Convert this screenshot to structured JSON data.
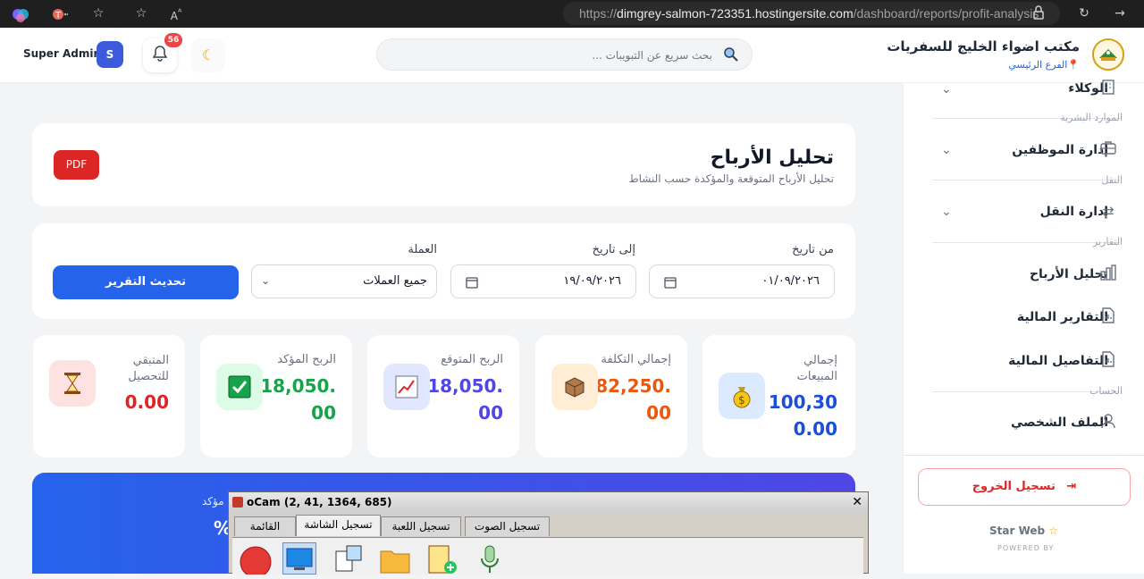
{
  "browser": {
    "url_prefix": "https://",
    "url_host": "dimgrey-salmon-723351.hostingersite.com",
    "url_path": "/dashboard/reports/profit-analysis"
  },
  "header": {
    "company_name": "مكتب اضواء الخليج للسفريات",
    "branch": "الفرع الرئيسي",
    "search_placeholder": "بحث سريع عن التبويبات ...",
    "notification_count": "56",
    "user_name": "Super Admin",
    "user_initial": "S"
  },
  "sidebar": {
    "agents": "الوكلاء",
    "section_hr": "الموارد البشرية",
    "employees": "إدارة الموظفين",
    "section_transport": "النقل",
    "transport": "إدارة النقل",
    "section_reports": "التقارير",
    "profit_analysis": "تحليل الأرباح",
    "financial_reports": "التقارير المالية",
    "financial_details": "التفاصيل المالية",
    "section_account": "الحساب",
    "profile": "الملف الشخصي",
    "logout": "تسجيل الخروج",
    "brand": "Star Web",
    "powered": "POWERED BY"
  },
  "page": {
    "title": "تحليل الأرباح",
    "subtitle": "تحليل الأرباح المتوقعة والمؤكدة حسب النشاط",
    "pdf_label": "PDF"
  },
  "filters": {
    "from_label": "من تاريخ",
    "from_value": "٠١/٠٩/٢٠٢٦",
    "to_label": "إلى تاريخ",
    "to_value": "١٩/٠٩/٢٠٢٦",
    "currency_label": "العملة",
    "currency_value": "جميع العملات",
    "update_button": "تحديث التقرير"
  },
  "stats": {
    "sales_label": "إجمالي المبيعات",
    "sales_value_1": "100,30",
    "sales_value_2": "0.00",
    "cost_label": "إجمالي التكلفة",
    "cost_value_1": "82,250.",
    "cost_value_2": "00",
    "expected_label": "الربح المتوقع",
    "expected_value_1": "18,050.",
    "expected_value_2": "00",
    "confirmed_label": "الربح المؤكد",
    "confirmed_value_1": "18,050.",
    "confirmed_value_2": "00",
    "remaining_label": "المتبقي للتحصيل",
    "remaining_value": "0.00"
  },
  "banner": {
    "partial_text": "مؤكد",
    "partial_pct": "%"
  },
  "ocam": {
    "title": "oCam (2, 41, 1364, 685)",
    "tab_list": "القائمة",
    "tab_screen": "تسجيل الشاشة",
    "tab_game": "تسجيل اللعبة",
    "tab_audio": "تسجيل الصوت"
  },
  "colors": {
    "primary": "#2563eb",
    "pdf_red": "#dc2626",
    "green": "#16a34a",
    "purple": "#4f46e5",
    "orange": "#ea580c",
    "red": "#dc2626",
    "blue": "#1d4ed8"
  }
}
